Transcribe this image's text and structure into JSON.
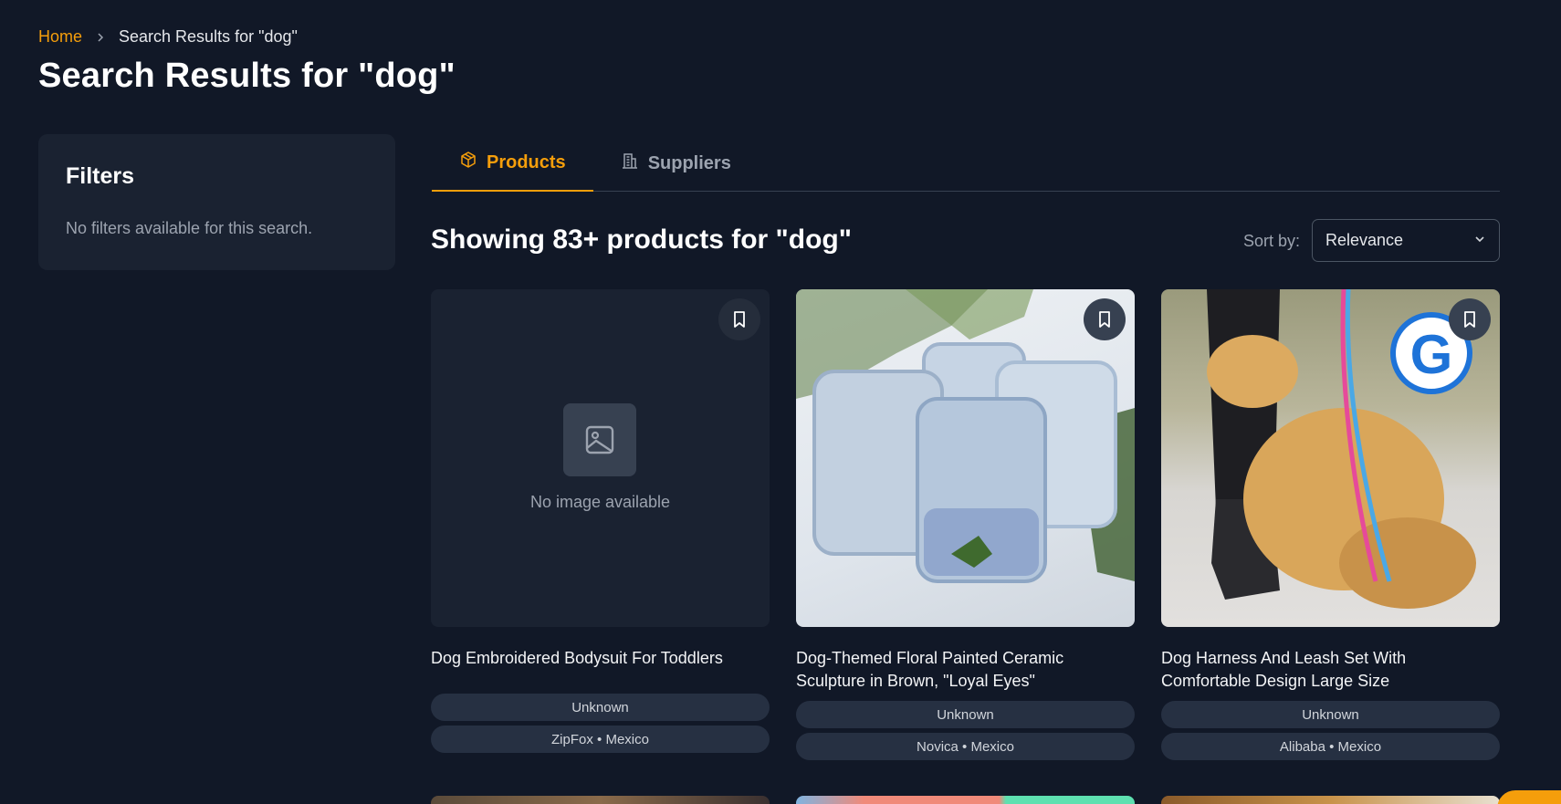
{
  "breadcrumb": {
    "home": "Home",
    "current": "Search Results for \"dog\""
  },
  "page_title": "Search Results for \"dog\"",
  "filters": {
    "title": "Filters",
    "empty_message": "No filters available for this search."
  },
  "tabs": [
    {
      "label": "Products",
      "icon": "box-icon",
      "active": true
    },
    {
      "label": "Suppliers",
      "icon": "building-icon",
      "active": false
    }
  ],
  "results": {
    "heading": "Showing 83+ products for \"dog\""
  },
  "sort": {
    "label": "Sort by:",
    "value": "Relevance"
  },
  "products": [
    {
      "title": "Dog Embroidered Bodysuit For Toddlers",
      "condition": "Unknown",
      "source": "ZipFox • Mexico",
      "image": "none",
      "no_image_text": "No image available"
    },
    {
      "title": "Dog-Themed Floral Painted Ceramic Sculpture in Brown, \"Loyal Eyes\"",
      "condition": "Unknown",
      "source": "Novica • Mexico",
      "image": "blue glass tumblers with ice and mint"
    },
    {
      "title": "Dog Harness And Leash Set With Comfortable Design Large Size",
      "condition": "Unknown",
      "source": "Alibaba • Mexico",
      "image": "golden retriever with rainbow leash"
    }
  ],
  "colors": {
    "accent": "#f59e0b",
    "background": "#111827",
    "panel": "#1a2231"
  }
}
